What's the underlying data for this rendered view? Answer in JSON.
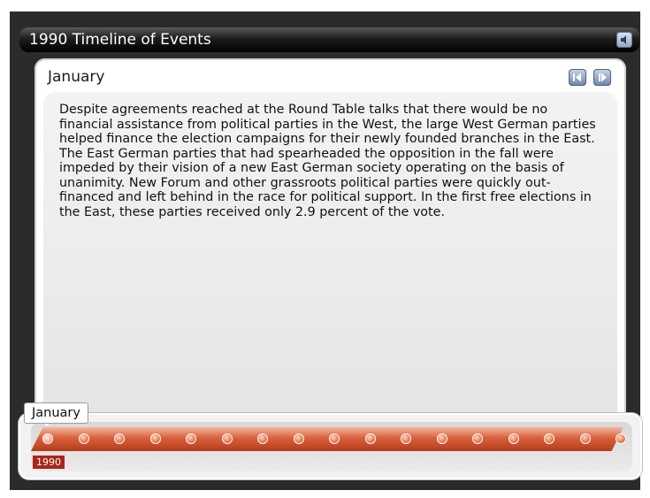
{
  "window": {
    "title": "1990 Timeline of Events"
  },
  "panel": {
    "month": "January",
    "body": "Despite agreements reached at the Round Table talks that there would be no financial assistance from political parties in the West, the large West German parties helped finance the election campaigns for their newly founded branches in the East. The East German parties that had spearheaded the opposition in the fall were impeded by their vision of a new East German society operating on the basis of unanimity. New Forum and other grassroots political parties were quickly out-financed and left behind in the race for political support. In the first free elections in the East, these parties received only 2.9 percent of the vote."
  },
  "timeline": {
    "current_label": "January",
    "year": "1990",
    "event_count": 17,
    "active_index": 0
  },
  "icons": {
    "sound": "speaker-icon",
    "prev": "previous-arrow-icon",
    "next": "next-arrow-icon"
  },
  "colors": {
    "track": "#d9603b",
    "year_badge": "#a8261b",
    "nav_button": "#6c83a8"
  }
}
